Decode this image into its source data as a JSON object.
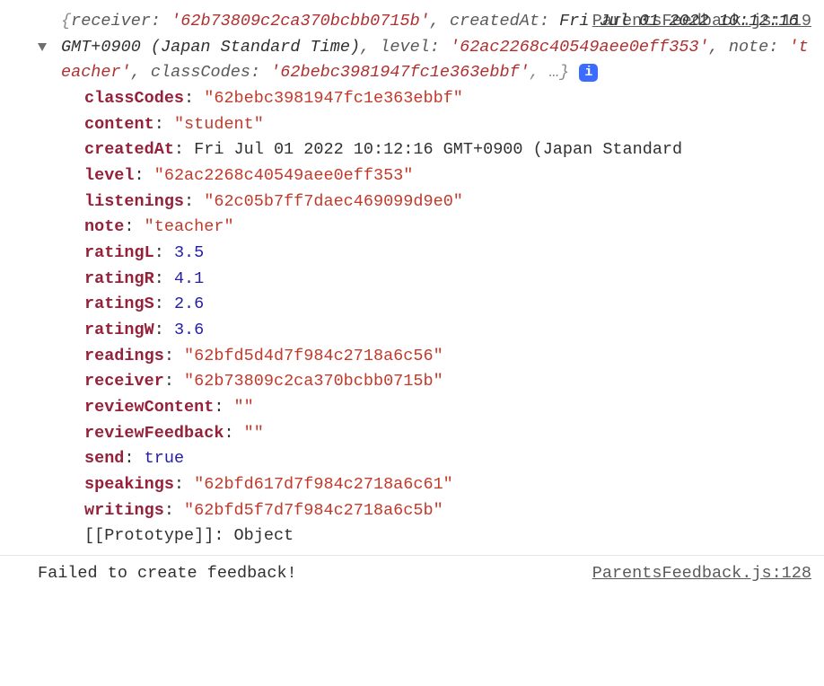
{
  "log1": {
    "source": "ParentsFeedback.js:119",
    "summary": {
      "open": "{",
      "receiver_k": "receiver: ",
      "receiver_v": "'62b73809c2ca370bcbb0715b'",
      "createdAt_k": ", createdAt: ",
      "createdAt_v": "Fri Jul 01 2022 10:12:16 GMT+0900 (Japan Standard Time)",
      "level_k": ", level: ",
      "level_v": "'62ac2268c40549aee0eff353'",
      "note_k": ", note: ",
      "note_v": "'teacher'",
      "cc_k": ", classCodes: ",
      "cc_v": "'62bebc3981947fc1e363ebbf'",
      "trail": ", …}",
      "badge": "i"
    },
    "props": {
      "classCodes": {
        "k": "classCodes",
        "v": "\"62bebc3981947fc1e363ebbf\"",
        "t": "str"
      },
      "content": {
        "k": "content",
        "v": "\"student\"",
        "t": "str"
      },
      "createdAt": {
        "k": "createdAt",
        "v": "Fri Jul 01 2022 10:12:16 GMT+0900 (Japan Standard",
        "t": "plain",
        "expander": true
      },
      "level": {
        "k": "level",
        "v": "\"62ac2268c40549aee0eff353\"",
        "t": "str"
      },
      "listenings": {
        "k": "listenings",
        "v": "\"62c05b7ff7daec469099d9e0\"",
        "t": "str"
      },
      "note": {
        "k": "note",
        "v": "\"teacher\"",
        "t": "str"
      },
      "ratingL": {
        "k": "ratingL",
        "v": "3.5",
        "t": "num"
      },
      "ratingR": {
        "k": "ratingR",
        "v": "4.1",
        "t": "num"
      },
      "ratingS": {
        "k": "ratingS",
        "v": "2.6",
        "t": "num"
      },
      "ratingW": {
        "k": "ratingW",
        "v": "3.6",
        "t": "num"
      },
      "readings": {
        "k": "readings",
        "v": "\"62bfd5d4d7f984c2718a6c56\"",
        "t": "str"
      },
      "receiver": {
        "k": "receiver",
        "v": "\"62b73809c2ca370bcbb0715b\"",
        "t": "str"
      },
      "reviewContent": {
        "k": "reviewContent",
        "v": "\"\"",
        "t": "str"
      },
      "reviewFeedback": {
        "k": "reviewFeedback",
        "v": "\"\"",
        "t": "str"
      },
      "send": {
        "k": "send",
        "v": "true",
        "t": "bool"
      },
      "speakings": {
        "k": "speakings",
        "v": "\"62bfd617d7f984c2718a6c61\"",
        "t": "str"
      },
      "writings": {
        "k": "writings",
        "v": "\"62bfd5f7d7f984c2718a6c5b\"",
        "t": "str"
      }
    },
    "proto": {
      "k": "[[Prototype]]",
      "v": "Object"
    }
  },
  "log2": {
    "source": "ParentsFeedback.js:128",
    "message": "Failed to create feedback!"
  }
}
